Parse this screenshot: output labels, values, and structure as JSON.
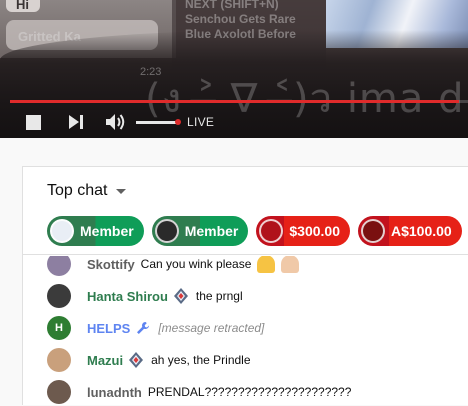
{
  "player": {
    "partial_top_left": "Hi",
    "partial_second": "Gritted Ka",
    "next_lines": [
      "NEXT (SHIFT+N)",
      "Senchou Gets Rare",
      "Blue Axolotl Before"
    ],
    "timestamp": "2:23",
    "overlay_kaomoji": "(ง ˃̶ ∇ ˂̶)ว ima d",
    "live_label": "LIVE",
    "progress_fraction": 0.98,
    "volume_fraction": 1.0,
    "icons": {
      "stop": "stop-icon",
      "next": "skip-next-icon",
      "volume": "volume-icon"
    },
    "colors": {
      "progress": "#e02b2b",
      "live_dot": "#e02b2b"
    }
  },
  "chat": {
    "mode_label": "Top chat",
    "tickers": [
      {
        "type": "member",
        "label": "Member",
        "avatar_color": "#e9eef5"
      },
      {
        "type": "member",
        "label": "Member",
        "avatar_color": "#2a2a2a"
      },
      {
        "type": "paid",
        "label": "$300.00",
        "avatar_color": "#b0121b"
      },
      {
        "type": "paid",
        "label": "A$100.00",
        "avatar_color": "#7a1010"
      }
    ],
    "messages": [
      {
        "author": "Skottify",
        "role": "normal",
        "text": "Can you wink please",
        "avatar_color": "#8d7fa1",
        "has_badge": false,
        "emojis": [
          "folded-hands-emoji",
          "folded-hands-light-emoji"
        ]
      },
      {
        "author": "Hanta Shirou",
        "role": "member",
        "text": "the prngl",
        "avatar_color": "#3b3b3b",
        "has_badge": true,
        "emojis": []
      },
      {
        "author": "HELPS",
        "role": "mod",
        "text": "[message retracted]",
        "avatar_color": "#2e7d32",
        "avatar_letter": "H",
        "has_badge": false,
        "emojis": []
      },
      {
        "author": "Mazui",
        "role": "member",
        "text": "ah yes, the Prindle",
        "avatar_color": "#c9a07c",
        "has_badge": true,
        "emojis": []
      },
      {
        "author": "lunadnth",
        "role": "normal",
        "text": "PRENDAL??????????????????????",
        "avatar_color": "#6d5a4e",
        "has_badge": false,
        "emojis": []
      }
    ]
  }
}
